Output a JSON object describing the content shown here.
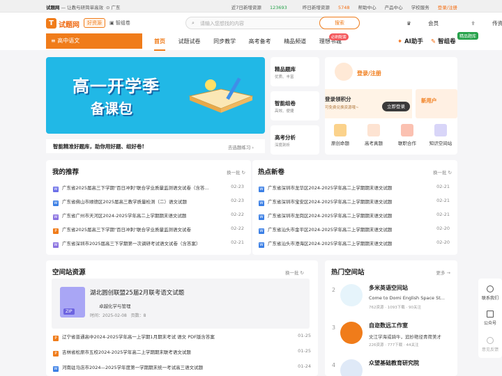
{
  "topbar": {
    "brand": "试题网",
    "slogan": "— 让教与研简单高效",
    "location": "广东",
    "new_today_label": "近7日新增资源",
    "new_today_value": "123693",
    "new_yesterday_label": "昨日新增资源",
    "new_yesterday_value": "5748",
    "links": [
      "帮助中心",
      "产品中心",
      "学校服务"
    ],
    "login": "登录/注册"
  },
  "header": {
    "logo_letter": "T",
    "logo_text": "试题网",
    "tag1": "好资源",
    "tag2": "智组卷",
    "search_placeholder": "请输入您想找的内容",
    "search_button": "搜索",
    "member": "会员",
    "upload": "传资料"
  },
  "subject": "高中语文",
  "nav": {
    "items": [
      "首页",
      "试题试卷",
      "同步教学",
      "高考备考",
      "精品频道",
      "理想书城"
    ],
    "badge": "必刷配套",
    "ai": "AI助手",
    "zu": "智组卷",
    "zu_badge": "精品题库"
  },
  "banner": {
    "line1": "高一开学季",
    "line2": "备课包"
  },
  "ticker": {
    "text": "智能精准好题库，助你用好题、组好卷!",
    "link": "去选题练习"
  },
  "minis": [
    {
      "title": "精品题库",
      "sub": "优质、丰富"
    },
    {
      "title": "智能组卷",
      "sub": "高效、便捷"
    },
    {
      "title": "高考分析",
      "sub": "深度剖析"
    }
  ],
  "login_card": {
    "login": "登录/注册",
    "promo_title": "登录领积分",
    "promo_sub": "可免费兑换资源哦~",
    "promo_btn": "立即登录",
    "promo2": "新用户",
    "quick": [
      "原创命题",
      "高考真题",
      "联职合作",
      "知识空间站"
    ]
  },
  "recommend": {
    "title": "我的推荐",
    "refresh": "换一批",
    "rows": [
      {
        "text": "广东省2025届高三下学期\"百日冲刺\"联合学业质量监测语文试卷（含答...",
        "date": "02-23",
        "kind": "w"
      },
      {
        "text": "广东省佛山市顺德区2025届高三教学质量检测（二）语文试题",
        "date": "02-23",
        "kind": "w"
      },
      {
        "text": "广东省广州市天河区2024-2025学年高二上学期期末语文试题",
        "date": "02-22",
        "kind": "p"
      },
      {
        "text": "广东省2025届高三下学期\"百日冲刺\"联合学业质量监测语文试卷",
        "date": "02-22",
        "kind": "o"
      },
      {
        "text": "广东省深圳市2025届高三下学期第一次调研考试语文试卷（含答案）",
        "date": "02-21",
        "kind": "p"
      }
    ]
  },
  "hot": {
    "title": "热点新卷",
    "refresh": "换一批",
    "rows": [
      {
        "text": "广东省深圳市龙华区2024-2025学年高二上学期期末语文试题",
        "date": "02-21"
      },
      {
        "text": "广东省深圳市宝安区2024-2025学年高二上学期期末语文试题",
        "date": "02-21"
      },
      {
        "text": "广东省深圳市龙岗区2024-2025学年高二上学期期末语文试题",
        "date": "02-21"
      },
      {
        "text": "广东省汕头市金平区2024-2025学年高二上学期期末语文试题",
        "date": "02-20"
      },
      {
        "text": "广东省汕头市澄海区2024-2025学年高二上学期期末语文试题",
        "date": "02-20"
      }
    ]
  },
  "space": {
    "title": "空间站资源",
    "refresh": "换一批",
    "featured": {
      "title": "湖北圆创联盟25届2月联考语文试题",
      "author": "卓越化学与管理",
      "time": "时间：2025-02-08",
      "pages": "页数：8",
      "zip": "ZIP"
    },
    "rows": [
      {
        "text": "辽宁省普通高中2024-2025学年高一上学期1月期末考试 语文 PDF版含答案",
        "date": "01-25"
      },
      {
        "text": "吉林省松原市五校2024-2025学年高二上学期期末联考语文试题",
        "date": "01-25"
      },
      {
        "text": "河南驻马店市2024—2025学年度第一学期期末统一考试高三语文试题",
        "date": "01-24"
      }
    ]
  },
  "stations": {
    "title": "热门空间站",
    "more": "更多 →",
    "items": [
      {
        "rank": "2",
        "name": "多米英语空间站",
        "desc": "Come to Domi English Space St...",
        "meta": "762资源 · 1093下载 · 90关注"
      },
      {
        "rank": "3",
        "name": "自迩数远工作室",
        "desc": "文江学海或骑牛，追妙艳径青荷美才",
        "meta": "226资源 · 777下载 · 44关注"
      },
      {
        "rank": "4",
        "name": "众望基础教育研究院",
        "desc": "",
        "meta": ""
      }
    ]
  },
  "sidebar": {
    "contact": "联系我们",
    "official": "公众号",
    "feedback": "意见反馈"
  },
  "colors": {
    "accent": "#f07c1a",
    "green": "#27a24b",
    "banner": "#21b8e6"
  }
}
